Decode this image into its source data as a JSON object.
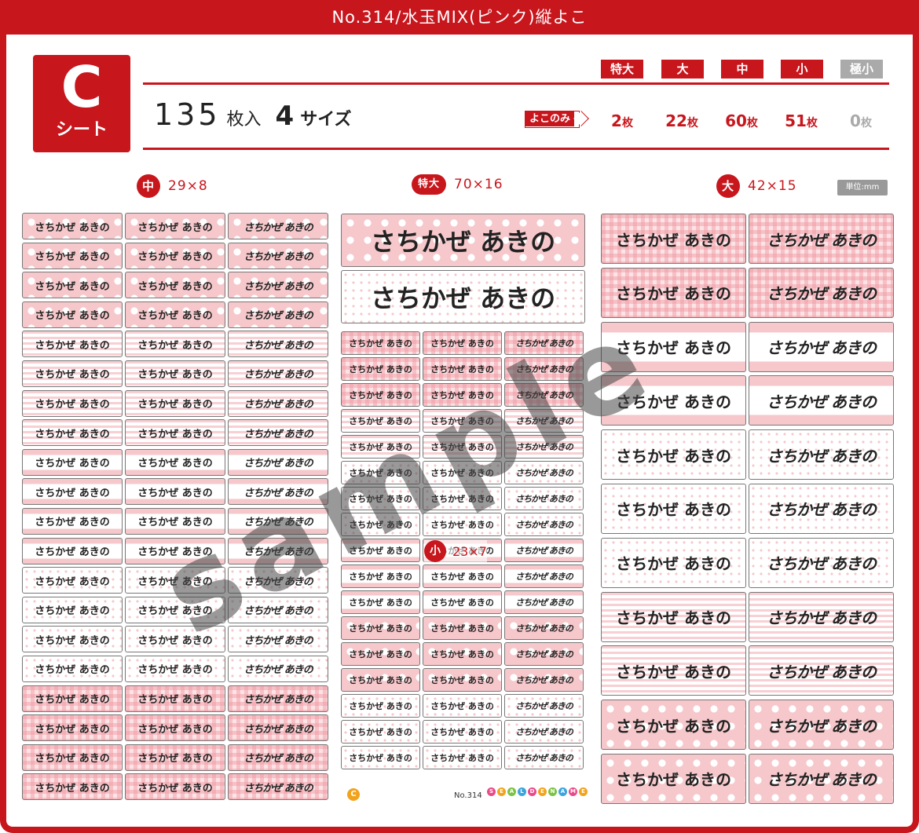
{
  "header": {
    "title": "No.314/水玉MIX(ピンク)縦よこ"
  },
  "sheet": {
    "letter": "C",
    "label": "シート"
  },
  "summary": {
    "count": "135",
    "count_unit": "枚入",
    "sizes": "4",
    "sizes_unit": "サイズ"
  },
  "size_badges": [
    {
      "label": "特大",
      "enabled": true
    },
    {
      "label": "大",
      "enabled": true
    },
    {
      "label": "中",
      "enabled": true
    },
    {
      "label": "小",
      "enabled": true
    },
    {
      "label": "極小",
      "enabled": false
    }
  ],
  "yoko_label": "よこのみ",
  "quantities": [
    {
      "value": "2",
      "unit": "枚",
      "enabled": true
    },
    {
      "value": "22",
      "unit": "枚",
      "enabled": true
    },
    {
      "value": "60",
      "unit": "枚",
      "enabled": true
    },
    {
      "value": "51",
      "unit": "枚",
      "enabled": true
    },
    {
      "value": "0",
      "unit": "枚",
      "enabled": false
    }
  ],
  "legends": {
    "medium": {
      "badge": "中",
      "dims": "29×8"
    },
    "xlarge": {
      "badge": "特大",
      "dims": "70×16"
    },
    "large": {
      "badge": "大",
      "dims": "42×15"
    },
    "small": {
      "badge": "小",
      "dims": "23×7"
    }
  },
  "unit_note": "単位:mm",
  "label_text": "さちかぜ あきの",
  "watermark": "sample",
  "footer": {
    "sheet_mark": "C",
    "number": "No.314",
    "brand": "SEALDENAME"
  },
  "colors": {
    "accent": "#c8161d",
    "pink": "#f6c8cb",
    "gray": "#aaaaaa"
  }
}
